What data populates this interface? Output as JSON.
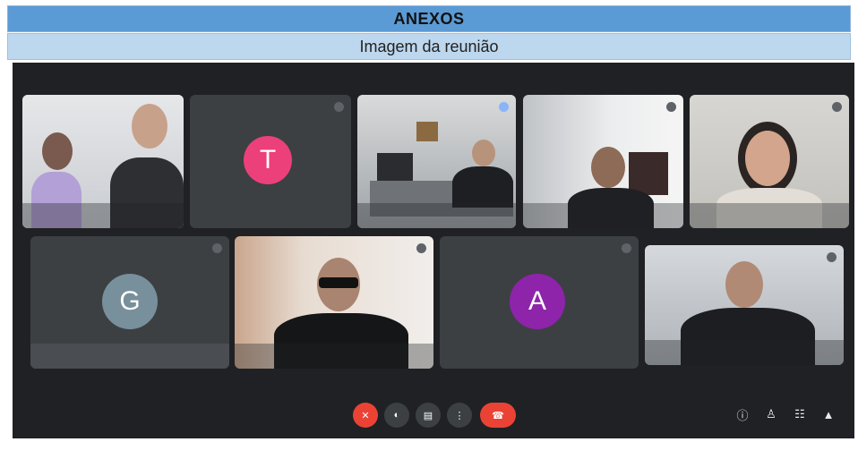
{
  "headers": {
    "annex_title": "ANEXOS",
    "section_title": "Imagem da reunião"
  },
  "tiles": {
    "t2_initial": "T",
    "g_initial": "G",
    "a_initial": "A"
  },
  "colors": {
    "meet_bg": "#202124",
    "tile_bg": "#3c4043",
    "avatar_t": "#ec407a",
    "avatar_g": "#78909c",
    "avatar_a": "#8e24aa",
    "leave_red": "#ea4335",
    "active_blue": "#8ab4f8"
  }
}
